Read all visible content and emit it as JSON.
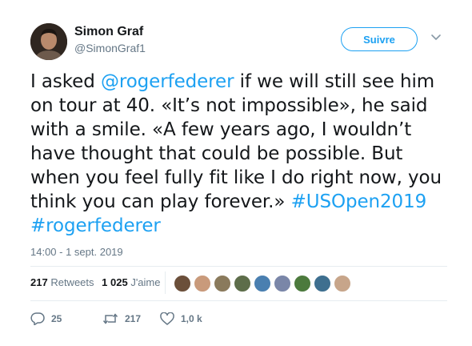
{
  "author": {
    "name": "Simon Graf",
    "handle": "@SimonGraf1"
  },
  "follow_label": "Suivre",
  "tweet": {
    "lines": [
      [
        {
          "t": "I asked "
        },
        {
          "t": "@rogerfederer",
          "link": true
        },
        {
          "t": " if we will still see him"
        }
      ],
      [
        {
          "t": "on tour at 40. «It’s not impossible», he said"
        }
      ],
      [
        {
          "t": "with a smile. «A few years ago, I wouldn’t"
        }
      ],
      [
        {
          "t": "have thought that could be possible. But"
        }
      ],
      [
        {
          "t": "when you feel fully fit like I do right now, you"
        }
      ],
      [
        {
          "t": "think you can play forever.» "
        },
        {
          "t": "#USOpen2019",
          "link": true
        }
      ],
      [
        {
          "t": "#rogerfederer",
          "link": true
        }
      ]
    ],
    "timestamp": "14:00 - 1 sept. 2019"
  },
  "stats": {
    "retweets_count": "217",
    "retweets_label": "Retweets",
    "likes_count": "1 025",
    "likes_label": "J'aime"
  },
  "likers": [
    {
      "name": "liker-avatar-1",
      "color": "#6b4f3a"
    },
    {
      "name": "liker-avatar-2",
      "color": "#c99a7b"
    },
    {
      "name": "liker-avatar-3",
      "color": "#8a7a5c"
    },
    {
      "name": "liker-avatar-4",
      "color": "#5d6d4a"
    },
    {
      "name": "liker-avatar-5",
      "color": "#4a7fb0"
    },
    {
      "name": "liker-avatar-6",
      "color": "#7a86a8"
    },
    {
      "name": "liker-avatar-7",
      "color": "#4c7a3d"
    },
    {
      "name": "liker-avatar-8",
      "color": "#3e6f8f"
    },
    {
      "name": "liker-avatar-9",
      "color": "#c7a58a"
    }
  ],
  "actions": {
    "replies": "25",
    "retweets": "217",
    "likes": "1,0 k"
  },
  "colors": {
    "accent": "#1da1f2",
    "secondary_text": "#657786",
    "primary_text": "#14171a"
  },
  "icons": {
    "reply": "reply-icon",
    "retweet": "retweet-icon",
    "like": "heart-icon",
    "menu": "chevron-down-icon"
  }
}
